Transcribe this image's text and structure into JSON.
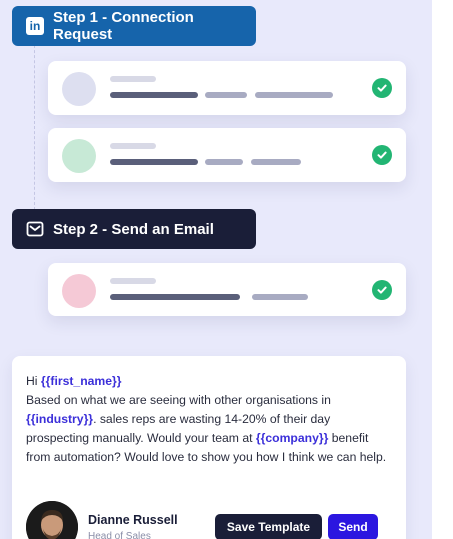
{
  "steps": [
    {
      "label": "Step 1 - Connection Request",
      "icon": "linkedin-icon",
      "icon_text": "in"
    },
    {
      "label": "Step 2 - Send an Email",
      "icon": "mail-icon"
    }
  ],
  "colors": {
    "step1": "#1664ab",
    "step2": "#1a1e38",
    "check": "#22b573",
    "variable": "#3b2fd9",
    "send": "#2b16e0",
    "avatar1": "#dddff0",
    "avatar2": "#c7e9d6",
    "avatar3": "#f5c9d6"
  },
  "email": {
    "greeting": "Hi ",
    "first_name_var": "{{first_name}}",
    "line1": "Based on what we are seeing with other organisations in",
    "industry_var": "{{industry}}",
    "line2": ". sales reps are wasting 14-20% of their day prospecting manually. Would your team at ",
    "company_var": "{{company}}",
    "line3": " benefit from automation? Would love to show you how I think we can help."
  },
  "sender": {
    "name": "Dianne Russell",
    "role": "Head of Sales"
  },
  "actions": {
    "save_label": "Save Template",
    "send_label": "Send"
  }
}
